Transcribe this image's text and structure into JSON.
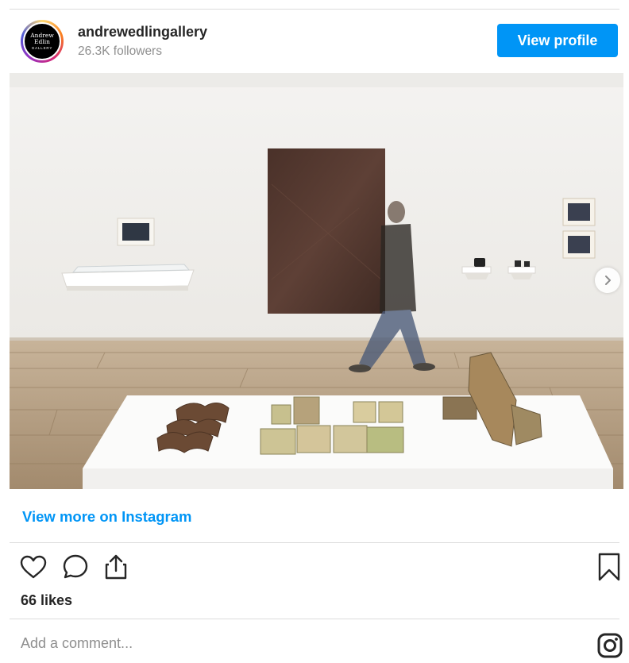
{
  "account": {
    "username": "andrewedlingallery",
    "followers": "26.3K followers",
    "avatar_text": {
      "line1": "Andrew",
      "line2": "Edlin",
      "line3": "GALLERY"
    }
  },
  "header": {
    "view_profile_label": "View profile"
  },
  "post": {
    "image_icon": "chevron-right-icon",
    "view_more_label": "View more on Instagram",
    "likes": "66 likes",
    "comment_placeholder": "Add a comment..."
  },
  "actions": {
    "like_icon": "heart-icon",
    "comment_icon": "comment-icon",
    "share_icon": "share-icon",
    "save_icon": "bookmark-icon",
    "brand_icon": "instagram-icon"
  },
  "colors": {
    "accent": "#0095f6",
    "secondary_text": "#8e8e8e",
    "divider": "#dbdbdb"
  }
}
